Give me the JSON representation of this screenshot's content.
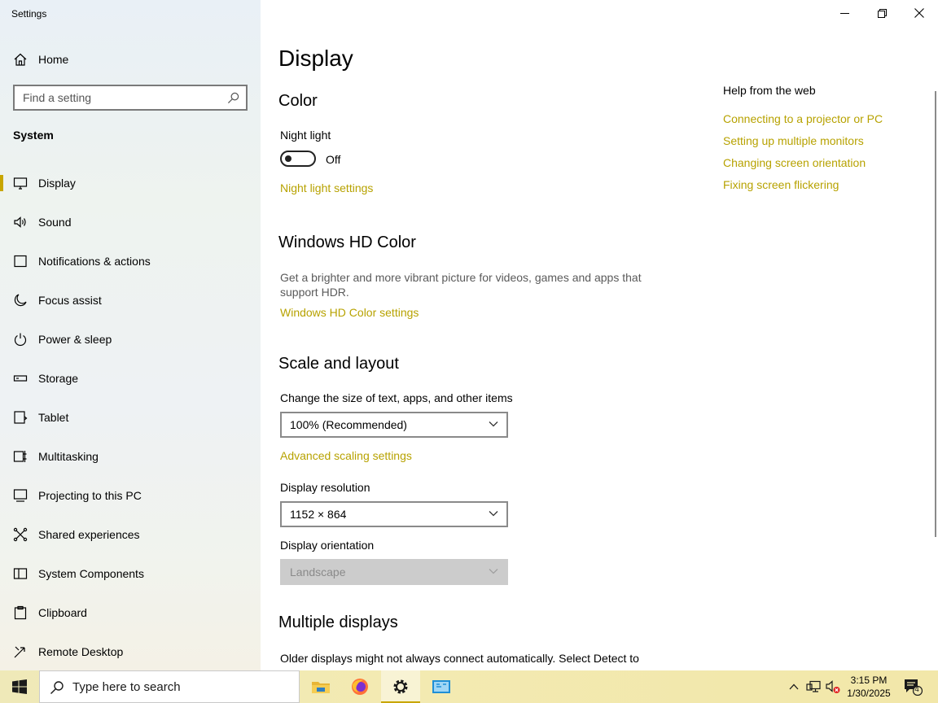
{
  "window": {
    "title": "Settings"
  },
  "sidebar": {
    "home_label": "Home",
    "search_placeholder": "Find a setting",
    "section_title": "System",
    "items": [
      {
        "label": "Display",
        "icon": "monitor-icon",
        "active": true
      },
      {
        "label": "Sound",
        "icon": "speaker-icon"
      },
      {
        "label": "Notifications & actions",
        "icon": "notification-icon"
      },
      {
        "label": "Focus assist",
        "icon": "moon-icon"
      },
      {
        "label": "Power & sleep",
        "icon": "power-icon"
      },
      {
        "label": "Storage",
        "icon": "storage-icon"
      },
      {
        "label": "Tablet",
        "icon": "tablet-icon"
      },
      {
        "label": "Multitasking",
        "icon": "multitasking-icon"
      },
      {
        "label": "Projecting to this PC",
        "icon": "projecting-icon"
      },
      {
        "label": "Shared experiences",
        "icon": "shared-experiences-icon"
      },
      {
        "label": "System Components",
        "icon": "system-components-icon"
      },
      {
        "label": "Clipboard",
        "icon": "clipboard-icon"
      },
      {
        "label": "Remote Desktop",
        "icon": "remote-desktop-icon"
      }
    ]
  },
  "main": {
    "page_title": "Display",
    "color": {
      "heading": "Color",
      "night_light_label": "Night light",
      "night_light_state": "Off",
      "night_light_settings_link": "Night light settings"
    },
    "hd_color": {
      "heading": "Windows HD Color",
      "description": "Get a brighter and more vibrant picture for videos, games and apps that support HDR.",
      "settings_link": "Windows HD Color settings"
    },
    "scale_layout": {
      "heading": "Scale and layout",
      "size_label": "Change the size of text, apps, and other items",
      "size_value": "100% (Recommended)",
      "advanced_link": "Advanced scaling settings",
      "resolution_label": "Display resolution",
      "resolution_value": "1152 × 864",
      "orientation_label": "Display orientation",
      "orientation_value": "Landscape"
    },
    "multiple_displays": {
      "heading": "Multiple displays",
      "description": "Older displays might not always connect automatically. Select Detect to"
    },
    "help": {
      "title": "Help from the web",
      "links": [
        "Connecting to a projector or PC",
        "Setting up multiple monitors",
        "Changing screen orientation",
        "Fixing screen flickering"
      ]
    }
  },
  "taskbar": {
    "search_placeholder": "Type here to search",
    "time": "3:15 PM",
    "date": "1/30/2025",
    "notification_count": "4",
    "apps": [
      "file-explorer-icon",
      "firefox-icon",
      "settings-gear-icon",
      "remote-app-icon"
    ]
  },
  "colors": {
    "accent": "#c8a600",
    "link": "#b7a200",
    "taskbar": "#f2e9b0"
  }
}
